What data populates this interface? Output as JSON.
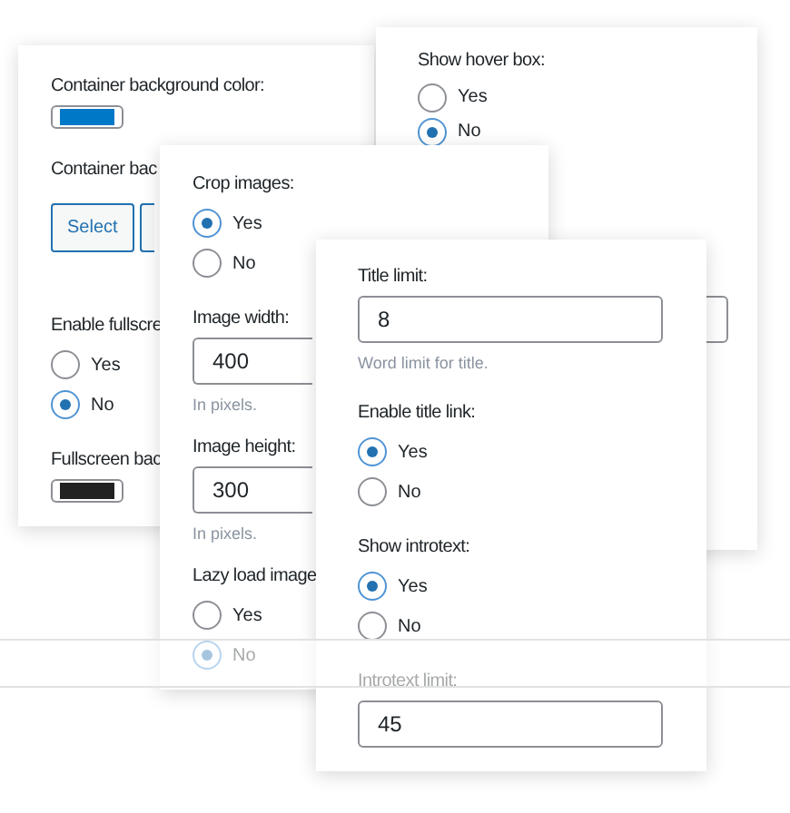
{
  "panels": [
    {
      "fields": [
        {
          "kind": "color",
          "label": "Container background color:",
          "color": "#0078c8"
        },
        {
          "kind": "buttons",
          "label": "Container bac",
          "buttons": [
            {
              "label": "Select"
            }
          ],
          "clipped": true
        },
        {
          "kind": "radio",
          "label": "Enable fullscre",
          "options": [
            {
              "label": "Yes",
              "selected": false
            },
            {
              "label": "No",
              "selected": true
            }
          ]
        },
        {
          "kind": "color",
          "label": "Fullscreen bac",
          "color": "#222222"
        }
      ]
    },
    {
      "fields": [
        {
          "kind": "radio",
          "label": "Show hover box:",
          "options": [
            {
              "label": "Yes",
              "selected": false
            },
            {
              "label": "No",
              "selected": true
            }
          ]
        },
        {
          "kind": "input"
        }
      ]
    },
    {
      "fields": [
        {
          "kind": "radio",
          "label": "Crop images:",
          "options": [
            {
              "label": "Yes",
              "selected": true
            },
            {
              "label": "No",
              "selected": false
            }
          ]
        },
        {
          "kind": "input",
          "label": "Image width:",
          "value": "400",
          "help": "In pixels."
        },
        {
          "kind": "input",
          "label": "Image height:",
          "value": "300",
          "help": "In pixels."
        },
        {
          "kind": "radio",
          "label": "Lazy load image",
          "options": [
            {
              "label": "Yes",
              "selected": false
            },
            {
              "label": "No",
              "selected": true
            }
          ]
        }
      ]
    },
    {
      "fields": [
        {
          "kind": "input",
          "label": "Title limit:",
          "value": "8",
          "help": "Word limit for title."
        },
        {
          "kind": "radio",
          "label": "Enable title link:",
          "options": [
            {
              "label": "Yes",
              "selected": true
            },
            {
              "label": "No",
              "selected": false
            }
          ]
        },
        {
          "kind": "radio",
          "label": "Show introtext:",
          "options": [
            {
              "label": "Yes",
              "selected": true
            },
            {
              "label": "No",
              "selected": false
            }
          ]
        },
        {
          "kind": "input",
          "label": "Introtext limit:",
          "value": "45"
        }
      ]
    }
  ]
}
